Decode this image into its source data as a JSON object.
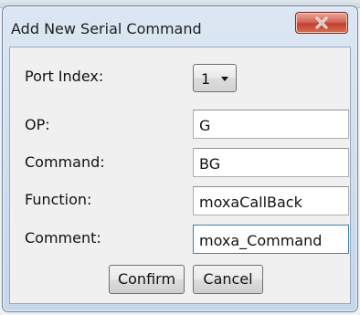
{
  "dialog": {
    "title": "Add New Serial Command",
    "close_icon": "close-x-icon"
  },
  "form": {
    "port_index": {
      "label": "Port Index:",
      "value": "1"
    },
    "op": {
      "label": "OP:",
      "value": "G"
    },
    "command": {
      "label": "Command:",
      "value": "BG"
    },
    "function": {
      "label": "Function:",
      "value": "moxaCallBack"
    },
    "comment": {
      "label": "Comment:",
      "value": "moxa_Command"
    }
  },
  "buttons": {
    "confirm": "Confirm",
    "cancel": "Cancel"
  }
}
